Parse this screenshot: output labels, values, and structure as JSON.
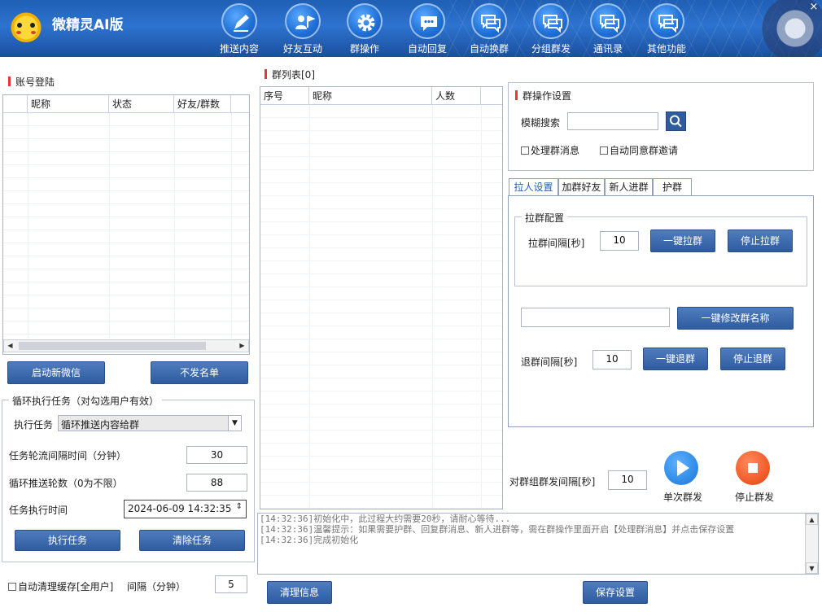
{
  "header": {
    "app_title": "微精灵AI版",
    "close": "×",
    "nav": [
      {
        "label": "推送内容",
        "icon": "pen-icon"
      },
      {
        "label": "好友互动",
        "icon": "user-flag-icon"
      },
      {
        "label": "群操作",
        "icon": "gear-icon"
      },
      {
        "label": "自动回复",
        "icon": "chat-bubble-icon"
      },
      {
        "label": "自动换群",
        "icon": "chat-bubbles-icon"
      },
      {
        "label": "分组群发",
        "icon": "chat-bubbles-icon"
      },
      {
        "label": "通讯录",
        "icon": "chat-bubbles-icon"
      },
      {
        "label": "其他功能",
        "icon": "chat-bubbles-icon"
      }
    ]
  },
  "accounts": {
    "title": "账号登陆",
    "columns": [
      "昵称",
      "状态",
      "好友/群数"
    ],
    "start_btn": "启动新微信",
    "blacklist_btn": "不发名单"
  },
  "loop": {
    "title": "循环执行任务（对勾选用户有效）",
    "task_label": "执行任务",
    "task_value": "循环推送内容给群",
    "interval_label": "任务轮流间隔时间（分钟）",
    "interval_value": "30",
    "rounds_label": "循环推送轮数（0为不限）",
    "rounds_value": "88",
    "time_label": "任务执行时间",
    "time_value": "2024-06-09 14:32:35",
    "run_btn": "执行任务",
    "clear_btn": "清除任务"
  },
  "cache": {
    "label": "自动清理缓存[全用户]",
    "interval_label": "间隔（分钟）",
    "interval_value": "5"
  },
  "group_list": {
    "title": "群列表[0]",
    "columns": [
      "序号",
      "昵称",
      "人数"
    ]
  },
  "settings": {
    "title": "群操作设置",
    "search_label": "模糊搜索",
    "search_value": "",
    "handle_msg": "处理群消息",
    "auto_accept": "自动同意群邀请"
  },
  "tabs": [
    "拉人设置",
    "加群好友",
    "新人进群",
    "护群"
  ],
  "pull": {
    "group_title": "拉群配置",
    "interval_label": "拉群间隔[秒]",
    "interval_value": "10",
    "pull_btn": "一键拉群",
    "stop_btn": "停止拉群",
    "rename_value": "",
    "rename_btn": "一键修改群名称",
    "quit_label": "退群间隔[秒]",
    "quit_value": "10",
    "quit_btn": "一键退群",
    "stop_quit_btn": "停止退群"
  },
  "broadcast": {
    "interval_label": "对群组群发间隔[秒]",
    "interval_value": "10",
    "single_label": "单次群发",
    "stop_label": "停止群发"
  },
  "log": [
    "[14:32:36]初始化中，此过程大约需要20秒，请耐心等待...",
    "[14:32:36]温馨提示：如果需要护群、回复群消息、新人进群等，需在群操作里面开启【处理群消息】并点击保存设置",
    "[14:32:36]完成初始化"
  ],
  "footer": {
    "clear_btn": "清理信息",
    "save_btn": "保存设置"
  },
  "colors": {
    "header": "#1f5fb5",
    "button": "#3b67aa",
    "accent_red": "#e53935",
    "play_blue": "#2f8be6",
    "stop_orange": "#f05a28"
  }
}
